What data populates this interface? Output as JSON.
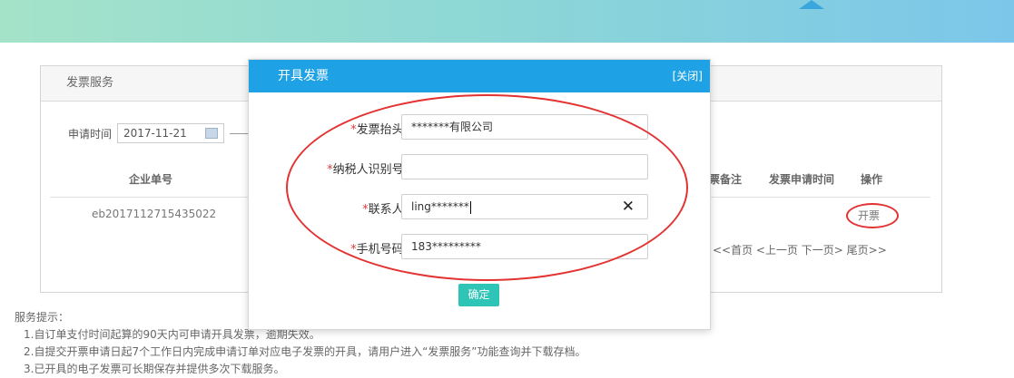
{
  "panel": {
    "title": "发票服务",
    "filter": {
      "label": "申请时间",
      "date": "2017-11-21"
    },
    "table": {
      "headers": {
        "order_no": "企业单号",
        "remark": "票备注",
        "apply_time": "发票申请时间",
        "action": "操作"
      },
      "rows": [
        {
          "order_no": "eb2017112715435022",
          "action": "开票"
        }
      ]
    },
    "pager": {
      "text": "<<首页 <上一页 下一页> 尾页>>"
    }
  },
  "modal": {
    "title": "开具发票",
    "close": "[关闭]",
    "fields": [
      {
        "required_mark": "*",
        "label": "发票抬头:",
        "value": "*******有限公司"
      },
      {
        "required_mark": "*",
        "label": "纳税人识别号:",
        "value": ""
      },
      {
        "required_mark": "*",
        "label": "联系人:",
        "value": "ling*******"
      },
      {
        "required_mark": "*",
        "label": "手机号码:",
        "value": "183*********"
      }
    ],
    "clear_icon": "✕",
    "confirm": "确定"
  },
  "hints": {
    "title": "服务提示：",
    "items": [
      "1.自订单支付时间起算的90天内可申请开具发票，逾期失效。",
      "2.自提交开票申请日起7个工作日内完成申请订单对应电子发票的开具，请用户进入“发票服务”功能查询并下载存档。",
      "3.已开具的电子发票可长期保存并提供多次下载服务。"
    ]
  },
  "colors": {
    "modal_header": "#1fa2e5",
    "confirm": "#2ec4b6",
    "annotation": "#e33232",
    "link": "#3fa9e0"
  },
  "icons": {
    "calendar": "calendar-icon",
    "clear": "clear-icon"
  }
}
